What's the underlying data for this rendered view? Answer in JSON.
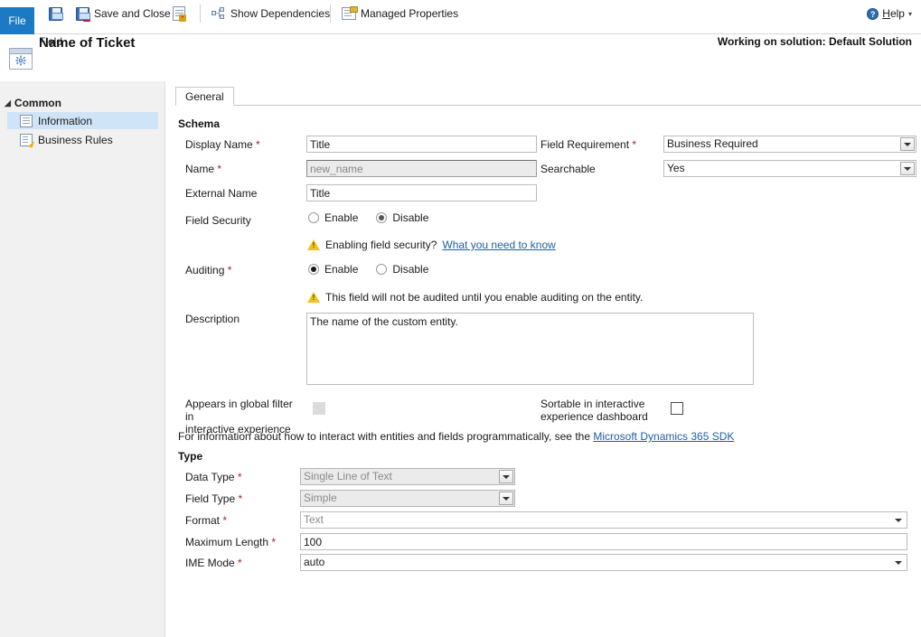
{
  "ribbon": {
    "file_tab": "File",
    "commands": [
      {
        "name": "save",
        "label": "",
        "icon": "save-icon"
      },
      {
        "name": "save-and-close",
        "label": "Save and Close",
        "icon": "save-and-close-icon"
      },
      {
        "name": "save-and-new",
        "label": "",
        "icon": "save-and-new-icon"
      },
      {
        "name": "show-dependencies",
        "label": "Show Dependencies",
        "icon": "dependencies-icon"
      },
      {
        "name": "managed-properties",
        "label": "Managed Properties",
        "icon": "managed-properties-icon"
      }
    ],
    "help": {
      "label_before": "",
      "accel": "H",
      "label_after": "elp",
      "full": "Help",
      "icon": "help-icon",
      "caret": "▾"
    }
  },
  "header": {
    "kicker": "Field",
    "title": "Name of Ticket",
    "solution_note": "Working on solution: Default Solution",
    "icon": "field-gear-icon"
  },
  "sidebar": {
    "group_label": "Common",
    "group_caret": "◢",
    "items": [
      {
        "label": "Information",
        "icon": "information-icon",
        "selected": true
      },
      {
        "label": "Business Rules",
        "icon": "business-rules-icon",
        "selected": false
      }
    ]
  },
  "tabs": [
    {
      "label": "General",
      "selected": true
    }
  ],
  "schema": {
    "section_title": "Schema",
    "display_name": {
      "label": "Display Name",
      "required": true,
      "value": "Title",
      "placeholder": ""
    },
    "name": {
      "label": "Name",
      "required": true,
      "value": "new_name",
      "disabled": true,
      "placeholder": ""
    },
    "external_name": {
      "label": "External Name",
      "required": false,
      "value": "Title",
      "placeholder": ""
    },
    "field_requirement": {
      "label": "Field Requirement",
      "required": true,
      "value": "Business Required"
    },
    "searchable": {
      "label": "Searchable",
      "required": false,
      "value": "Yes"
    },
    "field_security": {
      "label": "Field Security",
      "required": false,
      "options": [
        {
          "label": "Enable",
          "selected": false
        },
        {
          "label": "Disable",
          "selected": true
        }
      ],
      "warning_text": "Enabling field security?",
      "warning_link": "What you need to know"
    },
    "auditing": {
      "label": "Auditing",
      "required": true,
      "options": [
        {
          "label": "Enable",
          "selected": true
        },
        {
          "label": "Disable",
          "selected": false
        }
      ],
      "warning_text": "This field will not be audited until you enable auditing on the entity."
    },
    "description": {
      "label": "Description",
      "value": "The name of the custom entity.",
      "placeholder": ""
    },
    "global_filter": {
      "label_line1": "Appears in global filter in",
      "label_line2": "interactive experience",
      "checked": false,
      "disabled": true
    },
    "sortable": {
      "label_line1": "Sortable in interactive",
      "label_line2": "experience dashboard",
      "checked": false,
      "disabled": false
    },
    "sdk_note": "For information about how to interact with entities and fields programmatically, see the",
    "sdk_link": "Microsoft Dynamics 365 SDK"
  },
  "type": {
    "section_title": "Type",
    "data_type": {
      "label": "Data Type",
      "required": true,
      "value": "Single Line of Text",
      "disabled": true
    },
    "field_type": {
      "label": "Field Type",
      "required": true,
      "value": "Simple",
      "disabled": true
    },
    "format": {
      "label": "Format",
      "required": true,
      "value": "Text",
      "disabled": true
    },
    "maximum_length": {
      "label": "Maximum Length",
      "required": true,
      "value": "100",
      "placeholder": ""
    },
    "ime_mode": {
      "label": "IME Mode",
      "required": true,
      "value": "auto",
      "disabled": false
    }
  },
  "colors": {
    "file_tab_blue": "#1b7ac4",
    "selection_blue": "#cfe4f7",
    "sidebar_bg": "#f1f1f1",
    "required_asterisk": "#b02020",
    "link": "#1b5fa8",
    "warning_yellow": "#f2c21a"
  }
}
